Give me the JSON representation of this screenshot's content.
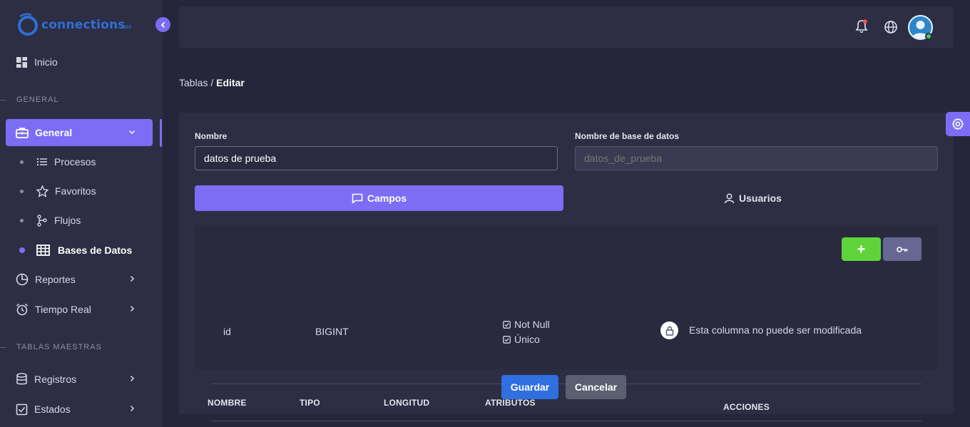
{
  "brand": {
    "name": "connections",
    "suffix": "sas",
    "color": "#2f6fd6"
  },
  "colors": {
    "accent": "#7c6df5",
    "add_button": "#5fd43a",
    "save_button": "#2f6fe0",
    "cancel_button": "#5b6070",
    "online": "#39d353"
  },
  "sidebar": {
    "home": {
      "label": "Inicio",
      "icon": "dashboard-icon"
    },
    "sections": [
      {
        "label": "GENERAL"
      },
      {
        "label": "TABLAS MAESTRAS"
      }
    ],
    "general": {
      "label": "General",
      "icon": "briefcase-icon",
      "children": [
        {
          "label": "Procesos",
          "icon": "list-icon"
        },
        {
          "label": "Favoritos",
          "icon": "star-icon"
        },
        {
          "label": "Flujos",
          "icon": "flow-icon"
        },
        {
          "label": "Bases de Datos",
          "icon": "table-grid-icon"
        }
      ]
    },
    "reportes": {
      "label": "Reportes",
      "icon": "pie-chart-icon"
    },
    "tiempo_real": {
      "label": "Tiempo Real",
      "icon": "alarm-clock-icon"
    },
    "registros": {
      "label": "Registros",
      "icon": "database-icon"
    },
    "estados": {
      "label": "Estados",
      "icon": "checkbox-icon"
    }
  },
  "header": {
    "notification_icon": "bell-icon",
    "language_icon": "globe-icon",
    "avatar_icon": "user-avatar-icon"
  },
  "breadcrumb": {
    "parent": "Tablas",
    "separator": " / ",
    "current": "Editar"
  },
  "form": {
    "nombre": {
      "label": "Nombre",
      "value": "datos de prueba"
    },
    "db_name": {
      "label": "Nombre de base de datos",
      "placeholder": "datos_de_prueba"
    }
  },
  "tabs": [
    {
      "label": "Campos",
      "icon": "chat-icon",
      "active": true
    },
    {
      "label": "Usuarios",
      "icon": "user-icon",
      "active": false
    }
  ],
  "table": {
    "columns": [
      "NOMBRE",
      "TIPO",
      "LONGITUD",
      "ATRIBUTOS",
      "ACCIONES"
    ],
    "rows": [
      {
        "nombre": "id",
        "tipo": "BIGINT",
        "longitud": "",
        "atributos": [
          "Not Null",
          "Único"
        ],
        "accion": "Esta columna no puede ser modificada"
      }
    ]
  },
  "buttons": {
    "add": "+",
    "save": "Guardar",
    "cancel": "Cancelar"
  }
}
